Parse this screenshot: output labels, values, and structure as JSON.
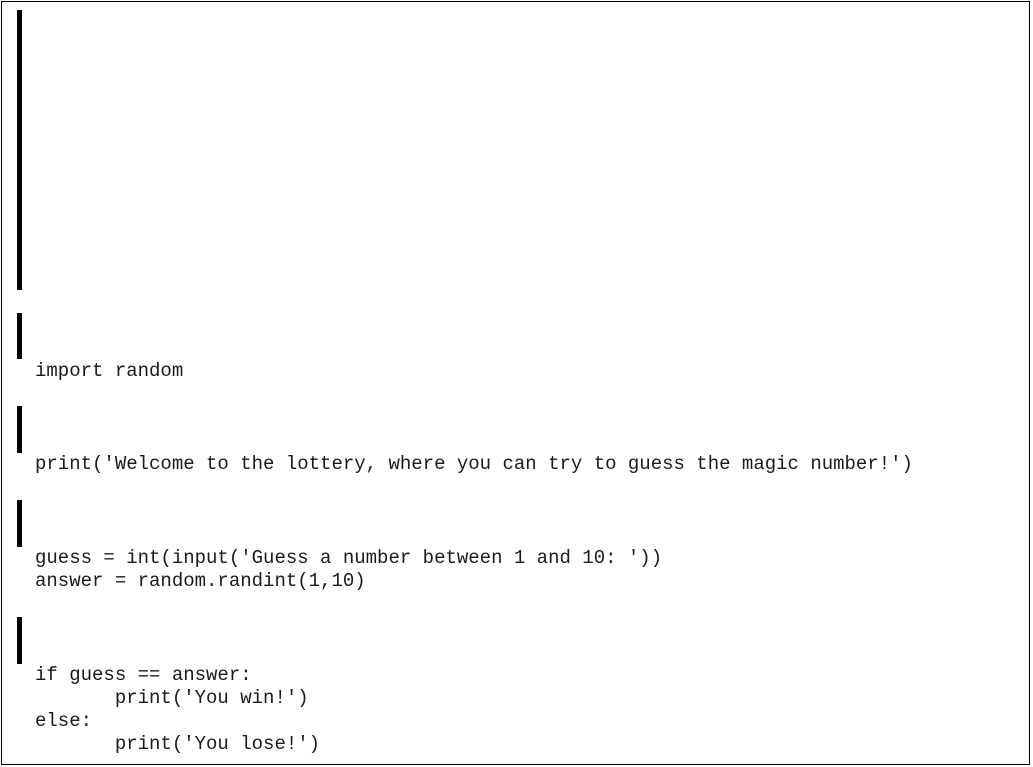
{
  "code": {
    "block1": {
      "lines": [
        "import random"
      ]
    },
    "block2": {
      "lines": [
        "print('Welcome to the lottery, where you can try to guess the magic number!')"
      ]
    },
    "block3": {
      "lines": [
        "guess = int(input('Guess a number between 1 and 10: '))",
        "answer = random.randint(1,10)"
      ]
    },
    "block4": {
      "lines": [
        "if guess == answer:",
        "       print('You win!')",
        "else:",
        "       print('You lose!')"
      ]
    }
  }
}
